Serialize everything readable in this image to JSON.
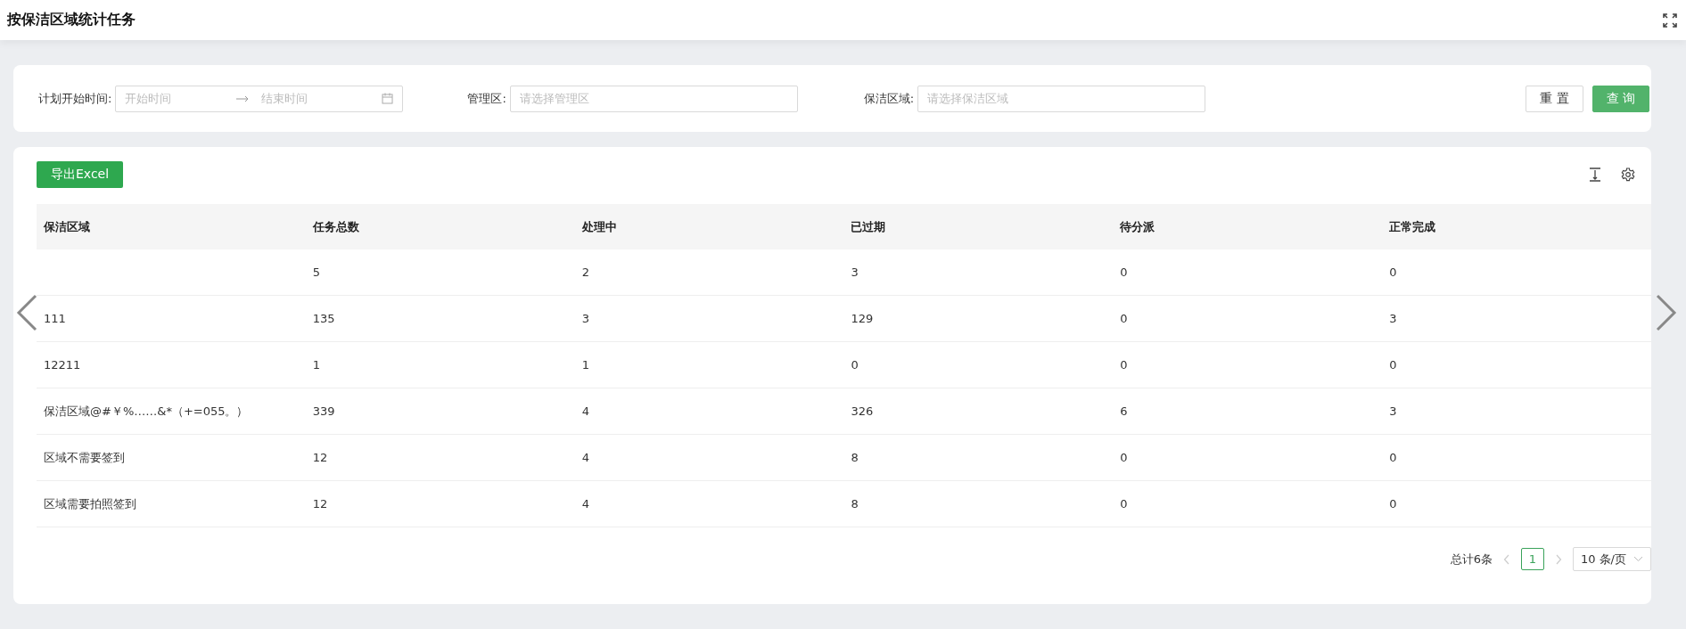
{
  "header": {
    "title": "按保洁区域统计任务"
  },
  "filters": [
    {
      "kind": "date_range",
      "label": "计划开始时间:",
      "start_placeholder": "开始时间",
      "end_placeholder": "结束时间"
    },
    {
      "kind": "select",
      "label": "管理区:",
      "placeholder": "请选择管理区"
    },
    {
      "kind": "select",
      "label": "保洁区域:",
      "placeholder": "请选择保洁区域"
    }
  ],
  "filter_buttons": [
    {
      "label": "重 置",
      "kind": "default"
    },
    {
      "label": "查 询",
      "kind": "primary"
    }
  ],
  "export_button": "导出Excel",
  "table": {
    "columns": [
      "保洁区域",
      "任务总数",
      "处理中",
      "已过期",
      "待分派",
      "正常完成"
    ],
    "rows": [
      [
        "",
        "5",
        "2",
        "3",
        "0",
        "0"
      ],
      [
        "111",
        "135",
        "3",
        "129",
        "0",
        "3"
      ],
      [
        "12211",
        "1",
        "1",
        "0",
        "0",
        "0"
      ],
      [
        "保洁区域@#￥%……&*（+=055。）",
        "339",
        "4",
        "326",
        "6",
        "3"
      ],
      [
        "区域不需要签到",
        "12",
        "4",
        "8",
        "0",
        "0"
      ],
      [
        "区域需要拍照签到",
        "12",
        "4",
        "8",
        "0",
        "0"
      ]
    ]
  },
  "pagination": {
    "total": "总计6条",
    "pages": [
      {
        "label": "1",
        "selected": true
      }
    ],
    "page_size": "10 条/页"
  }
}
